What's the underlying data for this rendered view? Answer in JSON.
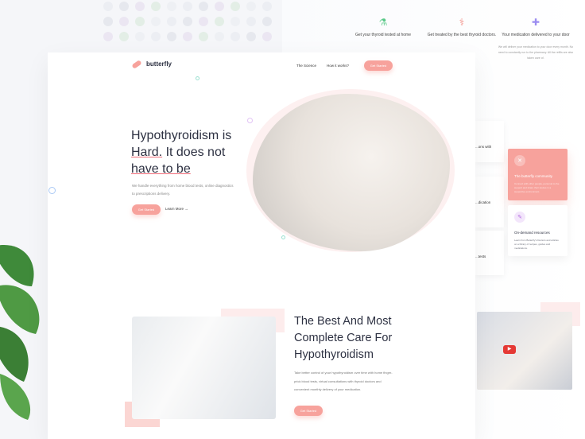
{
  "brand": {
    "name": "butterfly",
    "accent": "#f7a29c"
  },
  "nav": {
    "items": [
      "The Science",
      "How it works?"
    ],
    "cta": "Get Started"
  },
  "hero": {
    "title_line1": "Hypothyroidism is",
    "title_hard": "Hard.",
    "title_rest": " It does not",
    "title_line3": "have to be",
    "subtitle": "We handle everything from home blood tests, online diagnostics to prescriptions delivery.",
    "cta": "Get Started",
    "learn_more": "Learn More",
    "arrow": "→"
  },
  "features": [
    {
      "icon": "flask-icon",
      "glyph": "⚗",
      "color": "#5cc98a",
      "title": "Get your thyroid tested at home",
      "text": ""
    },
    {
      "icon": "stethoscope-icon",
      "glyph": "⚕",
      "color": "#f28b82",
      "title": "Get treated by the best thyroid doctors.",
      "text": ""
    },
    {
      "icon": "pills-icon",
      "glyph": "✚",
      "color": "#9b8cf0",
      "title": "Your medication delivered to your door",
      "text": "We will deliver your medication to your door every month. No need to constantly run to the pharmacy. All the refills are also taken care of."
    }
  ],
  "side_cards": [
    "...ons with",
    "...dication",
    "...tests"
  ],
  "cards": {
    "community": {
      "icon": "butterfly-icon",
      "title": "The butterfly community",
      "text": "Connect with other people, personal to the support and share their stories in a supportive environment."
    },
    "resources": {
      "icon": "pencil-icon",
      "title": "On-demand resources",
      "text": "Learn from Butterfly's Doctors and articles on a library of recipes, guides and medications."
    }
  },
  "care": {
    "title": "The Best And Most Complete Care For Hypothyroidism",
    "text": "Take better control of your hypothyroidism over time with home finger-prick blood tests, virtual consultations with thyroid doctors and convenient monthly delivery of your medication.",
    "cta": "Get Started"
  },
  "video": {
    "icon": "play-icon",
    "glyph": "▶"
  }
}
